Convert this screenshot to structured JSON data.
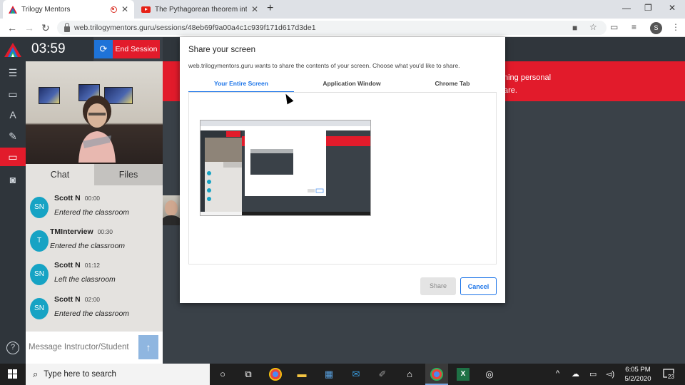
{
  "browser": {
    "tabs": [
      {
        "title": "Trilogy Mentors",
        "active": true
      },
      {
        "title": "The Pythagorean theorem intro |",
        "active": false
      }
    ],
    "url": "web.trilogymentors.guru/sessions/48eb69f9a00a4c1c939f171d617d3de1",
    "profile_initial": "S"
  },
  "session": {
    "timer": "03:59",
    "end_label": "End Session"
  },
  "panel": {
    "tabs": [
      "Chat",
      "Files"
    ],
    "messages": [
      {
        "initials": "SN",
        "name": "Scott N",
        "time": "00:00",
        "text": "Entered the classroom"
      },
      {
        "initials": "T",
        "name": "TMInterview",
        "time": "00:30",
        "text": "Entered the classroom"
      },
      {
        "initials": "SN",
        "name": "Scott N",
        "time": "01:12",
        "text": "Left the classroom"
      },
      {
        "initials": "SN",
        "name": "Scott N",
        "time": "02:00",
        "text": "Entered the classroom"
      }
    ],
    "composer_placeholder": "Message Instructor/Student"
  },
  "banner": {
    "line1": "ning personal",
    "line2": "are."
  },
  "dialog": {
    "title": "Share your screen",
    "subtitle": "web.trilogymentors.guru wants to share the contents of your screen. Choose what you'd like to share.",
    "tabs": [
      "Your Entire Screen",
      "Application Window",
      "Chrome Tab"
    ],
    "share_label": "Share",
    "cancel_label": "Cancel"
  },
  "taskbar": {
    "search_placeholder": "Type here to search",
    "time": "6:05 PM",
    "date": "5/2/2020",
    "notifications": "23"
  },
  "colors": {
    "brand_red": "#e21b2b",
    "accent_blue": "#1a73e8",
    "avatar_teal": "#16a3c4"
  }
}
